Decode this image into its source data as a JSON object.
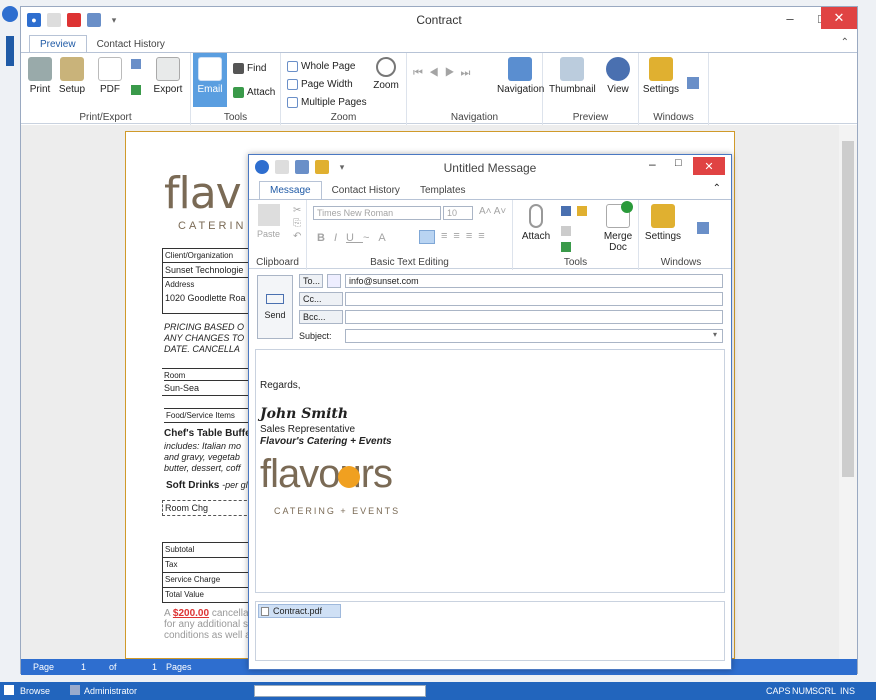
{
  "window": {
    "title": "Contract",
    "tabs": [
      "Preview",
      "Contact History"
    ]
  },
  "ribbon": {
    "groups": [
      {
        "label": "Print/Export",
        "buttons": [
          "Print",
          "Setup",
          "PDF",
          "Export"
        ]
      },
      {
        "label": "Tools",
        "buttons": [
          "Email"
        ],
        "small": [
          "Find",
          "Attach"
        ]
      },
      {
        "label": "Zoom",
        "small": [
          "Whole Page",
          "Page Width",
          "Multiple Pages"
        ],
        "buttons": [
          "Zoom"
        ]
      },
      {
        "label": "Navigation",
        "buttons": [
          "Navigation"
        ]
      },
      {
        "label": "Preview",
        "buttons": [
          "Thumbnail",
          "View"
        ]
      },
      {
        "label": "Windows",
        "buttons": [
          "Settings"
        ]
      }
    ]
  },
  "status": {
    "page_label": "Page",
    "page_num": "1",
    "of": "of",
    "total": "1",
    "pages": "Pages"
  },
  "taskbar": {
    "browse": "Browse",
    "user": "Administrator",
    "indicators": [
      "CAPS",
      "NUM",
      "SCRL",
      "INS"
    ]
  },
  "document": {
    "logo_text": "flav",
    "logo_sub": "CATERIN",
    "client_label": "Client/Organization",
    "client": "Sunset Technologie",
    "address_label": "Address",
    "address": "1020 Goodlette Roa",
    "pricing": [
      "PRICING BASED O",
      "ANY CHANGES TO",
      "DATE.  CANCELLA"
    ],
    "room_label": "Room",
    "room": "Sun-Sea",
    "food_label": "Food/Service Items",
    "chef": "Chef's Table Buffe",
    "includes": [
      "includes: Italian mo",
      "and gravy, vegetab",
      "butter, dessert, coff"
    ],
    "soft": "Soft Drinks",
    "soft_per": "-per gl",
    "room_chg": "Room Chg",
    "totals": [
      "Subtotal",
      "Tax",
      "Service Charge",
      "Total Value"
    ],
    "cancel_a": "A",
    "cancel_amt": "$200.00",
    "cancel_txt": "cancella",
    "footer": [
      "for any additional se",
      "conditions as well a"
    ]
  },
  "message": {
    "title": "Untitled Message",
    "tabs": [
      "Message",
      "Contact History",
      "Templates"
    ],
    "ribbon": {
      "clipboard": "Clipboard",
      "paste": "Paste",
      "font": "Times New Roman",
      "size": "10",
      "basic_text": "Basic Text Editing",
      "attach": "Attach",
      "merge": "Merge Doc",
      "tools": "Tools",
      "settings": "Settings",
      "windows": "Windows"
    },
    "send": "Send",
    "to_label": "To...",
    "to_value": "info@sunset.com",
    "cc_label": "Cc...",
    "bcc_label": "Bcc...",
    "subject_label": "Subject:",
    "subject_value": "",
    "body": {
      "greeting": "Regards,",
      "name": "John Smith",
      "role": "Sales Representative",
      "company": "Flavour's Catering + Events",
      "logo_main": "flavours",
      "logo_sub": "CATERING + EVENTS"
    },
    "attachment": "Contract.pdf"
  },
  "colors": {
    "accent": "#2e6ecf",
    "close": "#e04343",
    "logo": "#7a6a55",
    "orange": "#f0a020"
  }
}
